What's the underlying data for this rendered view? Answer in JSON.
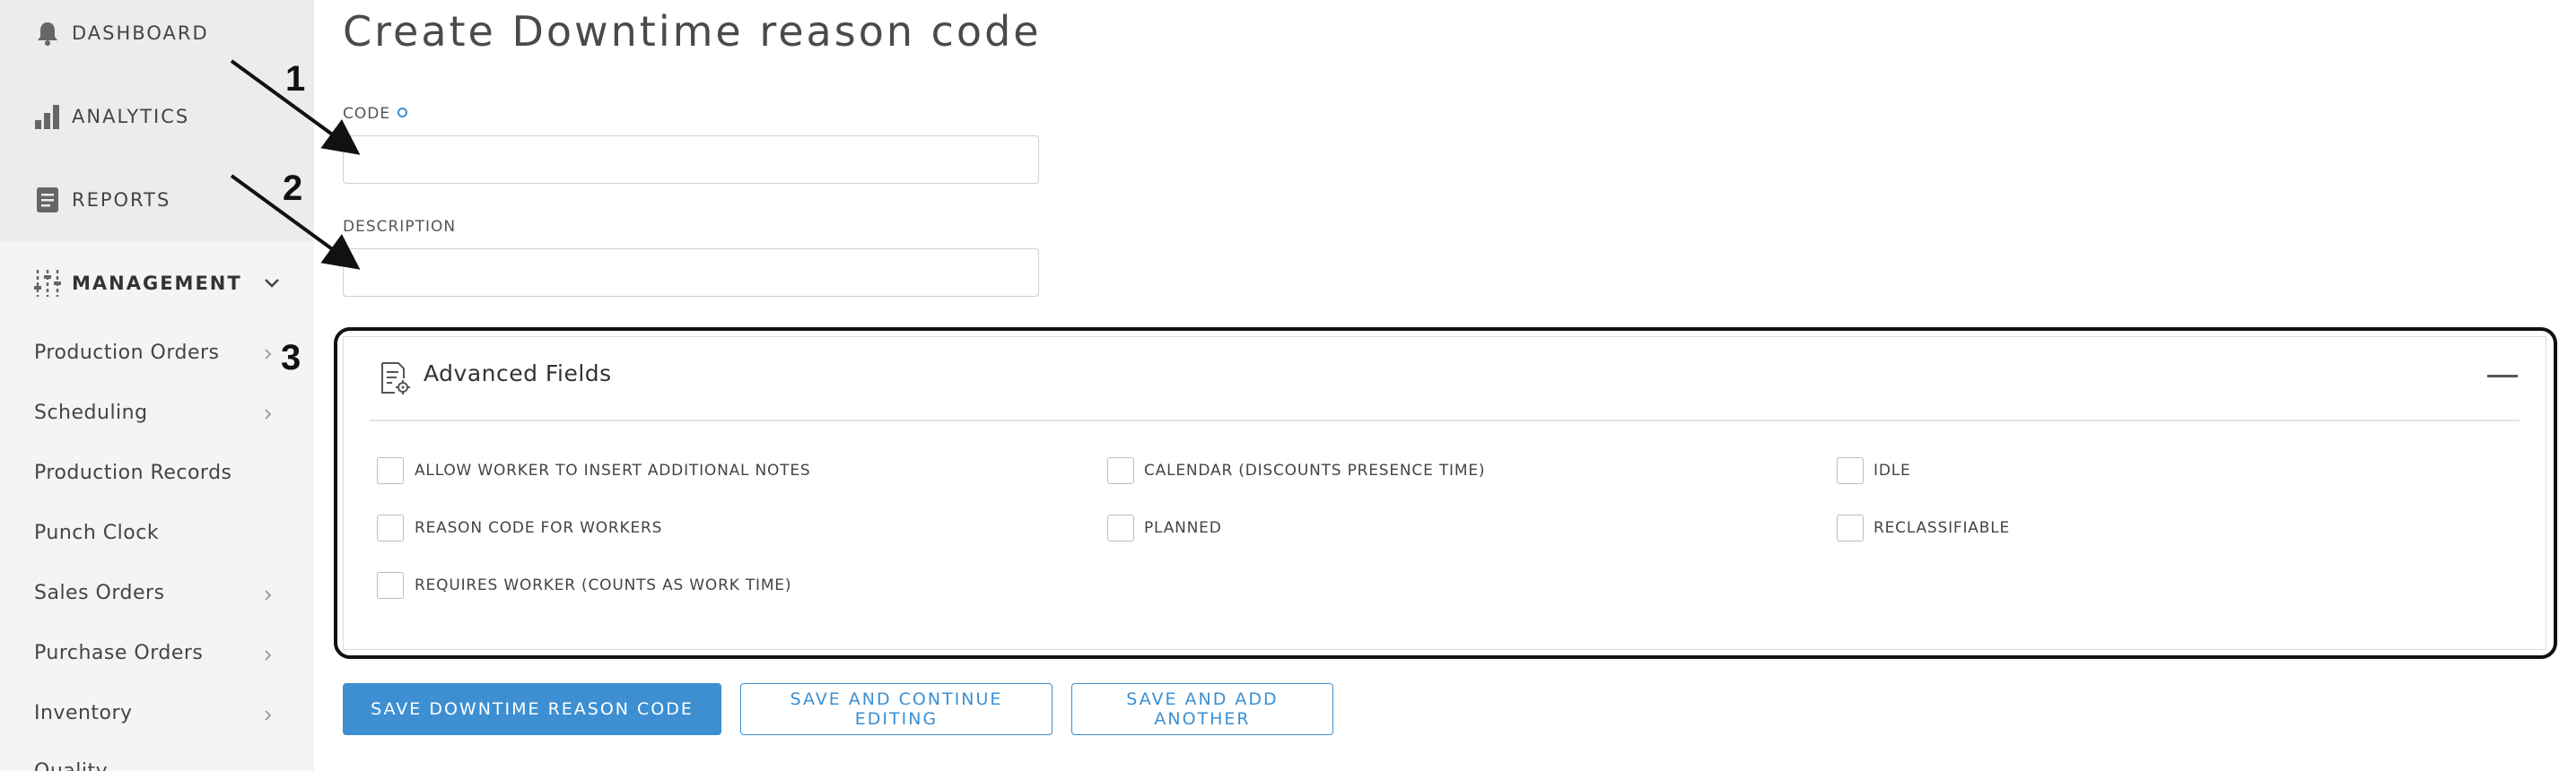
{
  "sidebar": {
    "main_items": [
      {
        "label": "DASHBOARD",
        "icon": "bell-icon"
      },
      {
        "label": "ANALYTICS",
        "icon": "bar-chart-icon"
      },
      {
        "label": "REPORTS",
        "icon": "report-icon"
      },
      {
        "label": "MANAGEMENT",
        "icon": "sliders-icon"
      }
    ],
    "sub_items": [
      {
        "label": "Production Orders",
        "has_chevron": true
      },
      {
        "label": "Scheduling",
        "has_chevron": true
      },
      {
        "label": "Production Records",
        "has_chevron": false
      },
      {
        "label": "Punch Clock",
        "has_chevron": false
      },
      {
        "label": "Sales Orders",
        "has_chevron": true
      },
      {
        "label": "Purchase Orders",
        "has_chevron": true
      },
      {
        "label": "Inventory",
        "has_chevron": true
      },
      {
        "label": "Quality",
        "has_chevron": false
      }
    ]
  },
  "page": {
    "title": "Create Downtime reason code"
  },
  "form": {
    "code_label": "CODE",
    "code_value": "",
    "description_label": "DESCRIPTION",
    "description_value": ""
  },
  "advanced": {
    "title": "Advanced Fields",
    "checkboxes": [
      {
        "label": "ALLOW WORKER TO INSERT ADDITIONAL NOTES",
        "checked": false
      },
      {
        "label": "CALENDAR (DISCOUNTS PRESENCE TIME)",
        "checked": false
      },
      {
        "label": "IDLE",
        "checked": false
      },
      {
        "label": "REASON CODE FOR WORKERS",
        "checked": false
      },
      {
        "label": "PLANNED",
        "checked": false
      },
      {
        "label": "RECLASSIFIABLE",
        "checked": false
      },
      {
        "label": "REQUIRES WORKER (COUNTS AS WORK TIME)",
        "checked": false
      }
    ]
  },
  "buttons": {
    "save": "SAVE DOWNTIME REASON CODE",
    "save_continue": "SAVE AND CONTINUE EDITING",
    "save_add": "SAVE AND ADD ANOTHER"
  },
  "annotations": [
    "1",
    "2",
    "3"
  ],
  "colors": {
    "accent": "#3d8fd1",
    "sidebar_bg": "#f4f4f4",
    "sidebar_top_bg": "#ececec"
  }
}
